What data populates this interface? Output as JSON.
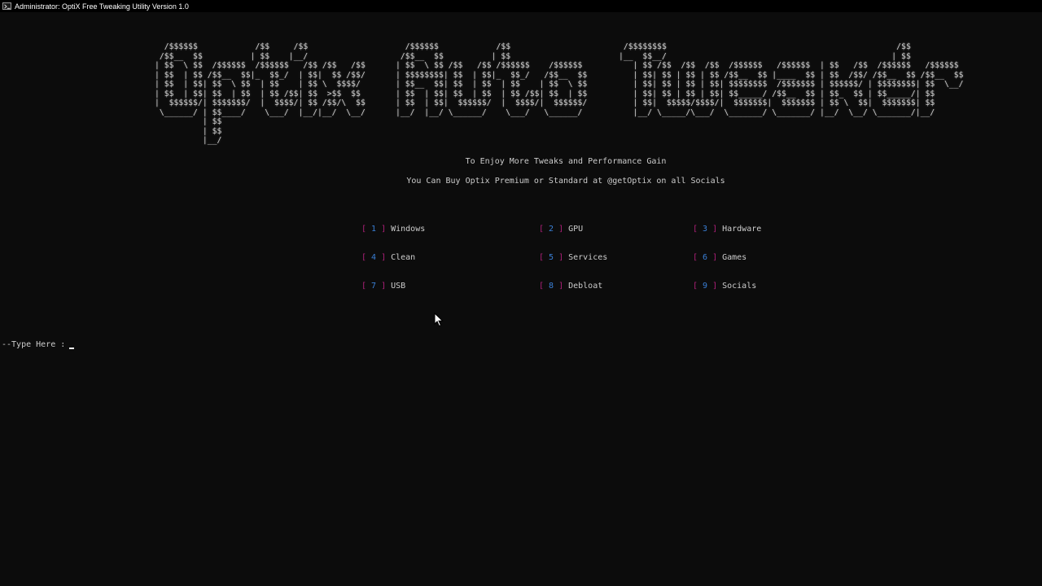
{
  "window": {
    "title": "Administrator:  OptiX Free Tweaking Utility Version 1.0"
  },
  "banner": {
    "word1": "  /$$$$$$            /$$     /$$\n /$$__  $$          | $$    |__/\n| $$  \\ $$  /$$$$$$  /$$$$$$   /$$ /$$   /$$\n| $$  | $$ /$$__  $$|_  $$_/  | $$|  $$ /$$/\n| $$  | $$| $$  \\ $$  | $$    | $$ \\  $$$$/\n| $$  | $$| $$  | $$  | $$ /$$| $$  >$$  $$\n|  $$$$$$/| $$$$$$$/  |  $$$$/| $$ /$$/\\  $$\n \\______/ | $$____/    \\___/  |__/|__/  \\__/\n          | $$\n          | $$\n          |__/",
    "word2": "  /$$$$$$            /$$\n /$$__  $$          | $$\n| $$  \\ $$ /$$   /$$ /$$$$$$    /$$$$$$\n| $$$$$$$$| $$  | $$|_  $$_/   /$$__  $$\n| $$__  $$| $$  | $$  | $$    | $$  \\ $$\n| $$  | $$| $$  | $$  | $$ /$$| $$  | $$\n| $$  | $$|  $$$$$$/  |  $$$$/|  $$$$$$/\n|__/  |__/ \\______/    \\___/   \\______/",
    "word3": " /$$$$$$$$                                                /$$\n|__  $$__/                                               | $$\n   | $$ /$$  /$$  /$$  /$$$$$$   /$$$$$$  | $$   /$$  /$$$$$$   /$$$$$$\n   | $$| $$ | $$ | $$ /$$__  $$ |____  $$ | $$  /$$/ /$$__  $$ /$$__  $$\n   | $$| $$ | $$ | $$| $$$$$$$$  /$$$$$$$ | $$$$$$/ | $$$$$$$$| $$  \\__/\n   | $$| $$ | $$ | $$| $$_____/ /$$__  $$ | $$_  $$ | $$_____/| $$\n   | $$|  $$$$$/$$$$/|  $$$$$$$|  $$$$$$$ | $$ \\  $$|  $$$$$$$| $$\n   |__/ \\_____/\\___/  \\_______/ \\_______/ |__/  \\__/ \\_______/|__/"
  },
  "taglines": {
    "line1": "To Enjoy More Tweaks and Performance Gain",
    "line2": "You Can Buy Optix Premium or Standard at @getOptix on all Socials"
  },
  "menu": {
    "bracket_open": "[",
    "bracket_close": "]",
    "items": [
      {
        "num": "1",
        "label": "Windows"
      },
      {
        "num": "2",
        "label": "GPU"
      },
      {
        "num": "3",
        "label": "Hardware"
      },
      {
        "num": "4",
        "label": "Clean"
      },
      {
        "num": "5",
        "label": "Services"
      },
      {
        "num": "6",
        "label": "Games"
      },
      {
        "num": "7",
        "label": "USB"
      },
      {
        "num": "8",
        "label": "Debloat"
      },
      {
        "num": "9",
        "label": "Socials"
      }
    ]
  },
  "prompt": {
    "label": "--Type Here :"
  },
  "colors": {
    "background": "#0c0c0c",
    "text": "#cccccc",
    "bracket": "#b0207a",
    "number": "#3a7fd6"
  }
}
